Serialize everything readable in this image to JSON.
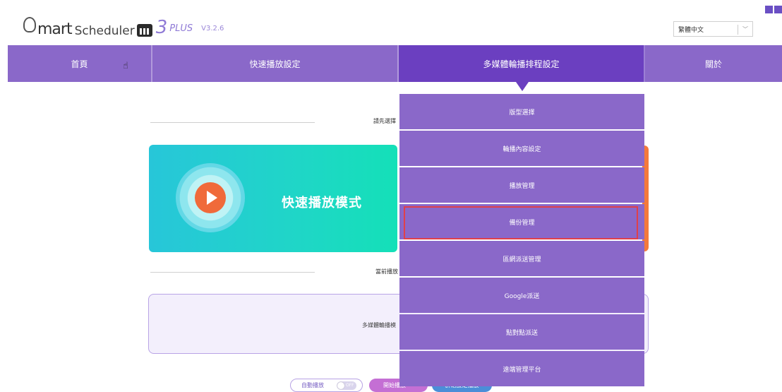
{
  "header": {
    "logo": {
      "word1": "mart",
      "word2": "Scheduler",
      "number": "3",
      "edition": "PLUS",
      "version": "V3.2.6"
    },
    "language": {
      "selected": "繁體中文"
    }
  },
  "nav": {
    "items": [
      {
        "label": "首頁"
      },
      {
        "label": "快速播放設定"
      },
      {
        "label": "多媒體輪播排程設定"
      },
      {
        "label": "關於"
      }
    ]
  },
  "main": {
    "select_prompt": "請先選擇",
    "fast_mode_label": "快速播放模式",
    "current_play_label": "當前播放",
    "multimedia_text": "多媒體輪播模",
    "auto_play_label": "自動播放",
    "auto_play_toggle": "OFF",
    "start_play_label": "開始播放",
    "group_label": "群組設定播放"
  },
  "dropdown": {
    "items": [
      {
        "label": "版型選擇"
      },
      {
        "label": "輪播內容設定"
      },
      {
        "label": "播放管理"
      },
      {
        "label": "備份管理"
      },
      {
        "label": "區網派送管理"
      },
      {
        "label": "Google派送"
      },
      {
        "label": "點對點派送"
      },
      {
        "label": "遠端管理平台"
      }
    ],
    "highlighted_index": 3
  },
  "colors": {
    "nav": "#8a68c9",
    "nav_active": "#6b3fc0",
    "highlight_border": "#e0404a",
    "fast_card": "#1fd6c7",
    "orange_card": "#f4793b"
  }
}
